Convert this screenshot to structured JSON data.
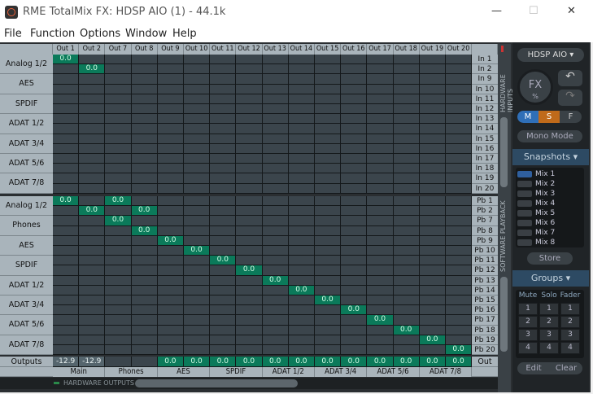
{
  "window": {
    "title": "RME TotalMix FX: HDSP AIO (1) - 44.1k",
    "minimize": "—",
    "maximize": "☐",
    "close": "✕"
  },
  "menu": [
    "File",
    "Function",
    "Options",
    "Window",
    "Help"
  ],
  "outputs": [
    "Out 1",
    "Out 2",
    "Out 7",
    "Out 8",
    "Out 9",
    "Out 10",
    "Out 11",
    "Out 12",
    "Out 13",
    "Out 14",
    "Out 15",
    "Out 16",
    "Out 17",
    "Out 18",
    "Out 19",
    "Out 20"
  ],
  "hardware_inputs": {
    "section_label": "HARDWARE INPUTS",
    "groups": [
      "Analog 1/2",
      "AES",
      "SPDIF",
      "ADAT 1/2",
      "ADAT 3/4",
      "ADAT 5/6",
      "ADAT 7/8"
    ],
    "rows": [
      {
        "label": "In 1",
        "values": [
          "0.0",
          "",
          "",
          "",
          "",
          "",
          "",
          "",
          "",
          "",
          "",
          "",
          "",
          "",
          "",
          ""
        ]
      },
      {
        "label": "In 2",
        "values": [
          "",
          "0.0",
          "",
          "",
          "",
          "",
          "",
          "",
          "",
          "",
          "",
          "",
          "",
          "",
          "",
          ""
        ]
      },
      {
        "label": "In 9",
        "values": [
          "",
          "",
          "",
          "",
          "",
          "",
          "",
          "",
          "",
          "",
          "",
          "",
          "",
          "",
          "",
          ""
        ]
      },
      {
        "label": "In 10",
        "values": [
          "",
          "",
          "",
          "",
          "",
          "",
          "",
          "",
          "",
          "",
          "",
          "",
          "",
          "",
          "",
          ""
        ]
      },
      {
        "label": "In 11",
        "values": [
          "",
          "",
          "",
          "",
          "",
          "",
          "",
          "",
          "",
          "",
          "",
          "",
          "",
          "",
          "",
          ""
        ]
      },
      {
        "label": "In 12",
        "values": [
          "",
          "",
          "",
          "",
          "",
          "",
          "",
          "",
          "",
          "",
          "",
          "",
          "",
          "",
          "",
          ""
        ]
      },
      {
        "label": "In 13",
        "values": [
          "",
          "",
          "",
          "",
          "",
          "",
          "",
          "",
          "",
          "",
          "",
          "",
          "",
          "",
          "",
          ""
        ]
      },
      {
        "label": "In 14",
        "values": [
          "",
          "",
          "",
          "",
          "",
          "",
          "",
          "",
          "",
          "",
          "",
          "",
          "",
          "",
          "",
          ""
        ]
      },
      {
        "label": "In 15",
        "values": [
          "",
          "",
          "",
          "",
          "",
          "",
          "",
          "",
          "",
          "",
          "",
          "",
          "",
          "",
          "",
          ""
        ]
      },
      {
        "label": "In 16",
        "values": [
          "",
          "",
          "",
          "",
          "",
          "",
          "",
          "",
          "",
          "",
          "",
          "",
          "",
          "",
          "",
          ""
        ]
      },
      {
        "label": "In 17",
        "values": [
          "",
          "",
          "",
          "",
          "",
          "",
          "",
          "",
          "",
          "",
          "",
          "",
          "",
          "",
          "",
          ""
        ]
      },
      {
        "label": "In 18",
        "values": [
          "",
          "",
          "",
          "",
          "",
          "",
          "",
          "",
          "",
          "",
          "",
          "",
          "",
          "",
          "",
          ""
        ]
      },
      {
        "label": "In 19",
        "values": [
          "",
          "",
          "",
          "",
          "",
          "",
          "",
          "",
          "",
          "",
          "",
          "",
          "",
          "",
          "",
          ""
        ]
      },
      {
        "label": "In 20",
        "values": [
          "",
          "",
          "",
          "",
          "",
          "",
          "",
          "",
          "",
          "",
          "",
          "",
          "",
          "",
          "",
          ""
        ]
      }
    ]
  },
  "software_playback": {
    "section_label": "SOFTWARE PLAYBACK",
    "groups": [
      "Analog 1/2",
      "Phones",
      "AES",
      "SPDIF",
      "ADAT 1/2",
      "ADAT 3/4",
      "ADAT 5/6",
      "ADAT 7/8"
    ],
    "rows": [
      {
        "label": "Pb 1",
        "values": [
          "0.0",
          "",
          "0.0",
          "",
          "",
          "",
          "",
          "",
          "",
          "",
          "",
          "",
          "",
          "",
          "",
          ""
        ]
      },
      {
        "label": "Pb 2",
        "values": [
          "",
          "0.0",
          "",
          "0.0",
          "",
          "",
          "",
          "",
          "",
          "",
          "",
          "",
          "",
          "",
          "",
          ""
        ]
      },
      {
        "label": "Pb 7",
        "values": [
          "",
          "",
          "0.0",
          "",
          "",
          "",
          "",
          "",
          "",
          "",
          "",
          "",
          "",
          "",
          "",
          ""
        ]
      },
      {
        "label": "Pb 8",
        "values": [
          "",
          "",
          "",
          "0.0",
          "",
          "",
          "",
          "",
          "",
          "",
          "",
          "",
          "",
          "",
          "",
          ""
        ]
      },
      {
        "label": "Pb 9",
        "values": [
          "",
          "",
          "",
          "",
          "0.0",
          "",
          "",
          "",
          "",
          "",
          "",
          "",
          "",
          "",
          "",
          ""
        ]
      },
      {
        "label": "Pb 10",
        "values": [
          "",
          "",
          "",
          "",
          "",
          "0.0",
          "",
          "",
          "",
          "",
          "",
          "",
          "",
          "",
          "",
          ""
        ]
      },
      {
        "label": "Pb 11",
        "values": [
          "",
          "",
          "",
          "",
          "",
          "",
          "0.0",
          "",
          "",
          "",
          "",
          "",
          "",
          "",
          "",
          ""
        ]
      },
      {
        "label": "Pb 12",
        "values": [
          "",
          "",
          "",
          "",
          "",
          "",
          "",
          "0.0",
          "",
          "",
          "",
          "",
          "",
          "",
          "",
          ""
        ]
      },
      {
        "label": "Pb 13",
        "values": [
          "",
          "",
          "",
          "",
          "",
          "",
          "",
          "",
          "0.0",
          "",
          "",
          "",
          "",
          "",
          "",
          ""
        ]
      },
      {
        "label": "Pb 14",
        "values": [
          "",
          "",
          "",
          "",
          "",
          "",
          "",
          "",
          "",
          "0.0",
          "",
          "",
          "",
          "",
          "",
          ""
        ]
      },
      {
        "label": "Pb 15",
        "values": [
          "",
          "",
          "",
          "",
          "",
          "",
          "",
          "",
          "",
          "",
          "0.0",
          "",
          "",
          "",
          "",
          ""
        ]
      },
      {
        "label": "Pb 16",
        "values": [
          "",
          "",
          "",
          "",
          "",
          "",
          "",
          "",
          "",
          "",
          "",
          "0.0",
          "",
          "",
          "",
          ""
        ]
      },
      {
        "label": "Pb 17",
        "values": [
          "",
          "",
          "",
          "",
          "",
          "",
          "",
          "",
          "",
          "",
          "",
          "",
          "0.0",
          "",
          "",
          ""
        ]
      },
      {
        "label": "Pb 18",
        "values": [
          "",
          "",
          "",
          "",
          "",
          "",
          "",
          "",
          "",
          "",
          "",
          "",
          "",
          "0.0",
          "",
          ""
        ]
      },
      {
        "label": "Pb 19",
        "values": [
          "",
          "",
          "",
          "",
          "",
          "",
          "",
          "",
          "",
          "",
          "",
          "",
          "",
          "",
          "0.0",
          ""
        ]
      },
      {
        "label": "Pb 20",
        "values": [
          "",
          "",
          "",
          "",
          "",
          "",
          "",
          "",
          "",
          "",
          "",
          "",
          "",
          "",
          "",
          "0.0"
        ]
      }
    ]
  },
  "outputs_row": {
    "label": "Outputs",
    "right_label": "Out",
    "values": [
      "-12.9",
      "-12.9",
      "",
      "",
      "0.0",
      "0.0",
      "0.0",
      "0.0",
      "0.0",
      "0.0",
      "0.0",
      "0.0",
      "0.0",
      "0.0",
      "0.0",
      "0.0"
    ]
  },
  "output_groups": [
    "Main",
    "Phones",
    "AES",
    "SPDIF",
    "ADAT 1/2",
    "ADAT 3/4",
    "ADAT 5/6",
    "ADAT 7/8"
  ],
  "bottom_label": "HARDWARE OUTPUTS",
  "panel": {
    "device": "HDSP AIO",
    "fx": "FX",
    "fx_unit": "%",
    "undo": "↶",
    "redo": "↷",
    "m": "M",
    "s": "S",
    "f": "F",
    "mono_mode": "Mono Mode",
    "snapshots_title": "Snapshots",
    "snapshots": [
      "Mix 1",
      "Mix 2",
      "Mix 3",
      "Mix 4",
      "Mix 5",
      "Mix 6",
      "Mix 7",
      "Mix 8"
    ],
    "selected_snapshot": "Mix 1",
    "store": "Store",
    "groups_title": "Groups",
    "group_headers": [
      "Mute",
      "Solo",
      "Fader"
    ],
    "group_numbers": [
      "1",
      "2",
      "3",
      "4"
    ],
    "edit": "Edit",
    "clear": "Clear"
  },
  "colors": {
    "active_cell": "#0b7a5a",
    "cell": "#3b454c",
    "label": "#a9b4bb",
    "m_button": "#2f6fb8",
    "s_button": "#c06a1a"
  }
}
